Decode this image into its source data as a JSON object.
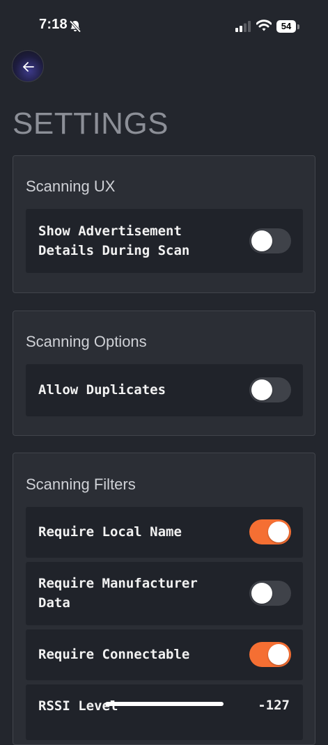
{
  "status_bar": {
    "time": "7:18",
    "battery": "54"
  },
  "header": {
    "back_icon": "arrow-left-icon",
    "title": "SETTINGS"
  },
  "sections": [
    {
      "title": "Scanning UX",
      "rows": [
        {
          "label": "Show Advertisement\nDetails During Scan",
          "toggle_on": false
        }
      ]
    },
    {
      "title": "Scanning Options",
      "rows": [
        {
          "label": "Allow Duplicates",
          "toggle_on": false
        }
      ]
    },
    {
      "title": "Scanning Filters",
      "rows": [
        {
          "label": "Require Local Name",
          "toggle_on": true
        },
        {
          "label": "Require Manufacturer\nData",
          "toggle_on": false
        },
        {
          "label": "Require Connectable",
          "toggle_on": true
        },
        {
          "label": "RSSI Level",
          "value": "-127"
        }
      ]
    }
  ],
  "colors": {
    "background": "#23262d",
    "card": "#2b2e35",
    "row": "#20232a",
    "toggle_on": "#f56f33",
    "toggle_off": "#3f4249"
  }
}
